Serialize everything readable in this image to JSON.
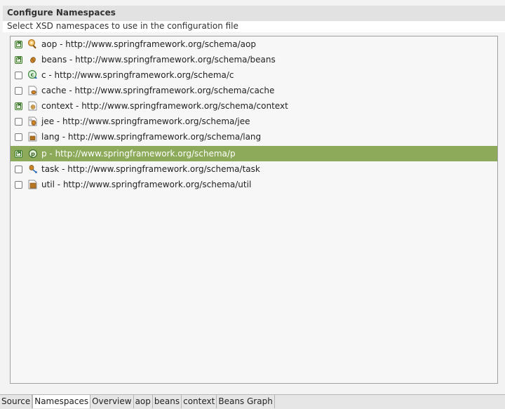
{
  "header": {
    "title": "Configure Namespaces",
    "description": "Select XSD namespaces to use in the configuration file"
  },
  "namespaces": [
    {
      "label": "aop - http://www.springframework.org/schema/aop",
      "checked": true,
      "icon": "aop-icon"
    },
    {
      "label": "beans - http://www.springframework.org/schema/beans",
      "checked": true,
      "icon": "beans-icon"
    },
    {
      "label": "c - http://www.springframework.org/schema/c",
      "checked": false,
      "icon": "c-namespace-icon"
    },
    {
      "label": "cache - http://www.springframework.org/schema/cache",
      "checked": false,
      "icon": "cache-icon"
    },
    {
      "label": "context - http://www.springframework.org/schema/context",
      "checked": true,
      "icon": "context-icon"
    },
    {
      "label": "jee - http://www.springframework.org/schema/jee",
      "checked": false,
      "icon": "jee-icon"
    },
    {
      "label": "lang - http://www.springframework.org/schema/lang",
      "checked": false,
      "icon": "lang-icon"
    },
    {
      "label": "p - http://www.springframework.org/schema/p",
      "checked": true,
      "selected": true,
      "icon": "p-namespace-icon"
    },
    {
      "label": "task - http://www.springframework.org/schema/task",
      "checked": false,
      "icon": "task-icon"
    },
    {
      "label": "util - http://www.springframework.org/schema/util",
      "checked": false,
      "icon": "util-icon"
    }
  ],
  "tabs": [
    {
      "label": "Source",
      "active": false
    },
    {
      "label": "Namespaces",
      "active": true
    },
    {
      "label": "Overview",
      "active": false
    },
    {
      "label": "aop",
      "active": false
    },
    {
      "label": "beans",
      "active": false
    },
    {
      "label": "context",
      "active": false
    },
    {
      "label": "Beans Graph",
      "active": false
    }
  ],
  "colors": {
    "selection": "#8caa5a",
    "checkbox_checked": "#3f7a2c",
    "bean_icon": "#c9852a"
  }
}
